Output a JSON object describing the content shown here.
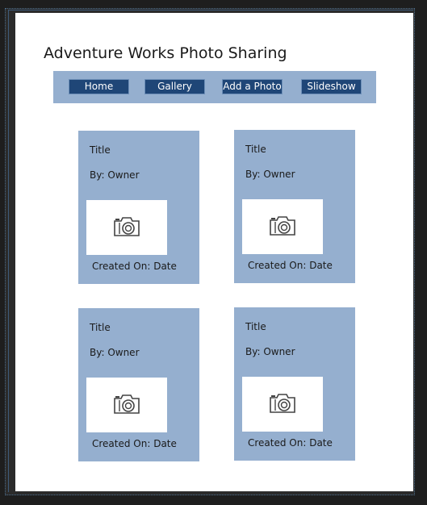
{
  "site": {
    "title": "Adventure Works Photo Sharing"
  },
  "nav": {
    "items": [
      {
        "label": "Home"
      },
      {
        "label": "Gallery"
      },
      {
        "label": "Add a Photo"
      },
      {
        "label": "Slideshow"
      }
    ]
  },
  "cards": [
    {
      "title": "Title",
      "owner": "By: Owner",
      "created": "Created On: Date",
      "icon": "camera-icon"
    },
    {
      "title": "Title",
      "owner": "By: Owner",
      "created": "Created On: Date",
      "icon": "camera-icon"
    },
    {
      "title": "Title",
      "owner": "By: Owner",
      "created": "Created On: Date",
      "icon": "camera-icon"
    },
    {
      "title": "Title",
      "owner": "By: Owner",
      "created": "Created On: Date",
      "icon": "camera-icon"
    }
  ],
  "colors": {
    "nav_background": "#95afcf",
    "nav_button": "#1f4677",
    "card_background": "#95afcf",
    "page_background": "#ffffff"
  }
}
